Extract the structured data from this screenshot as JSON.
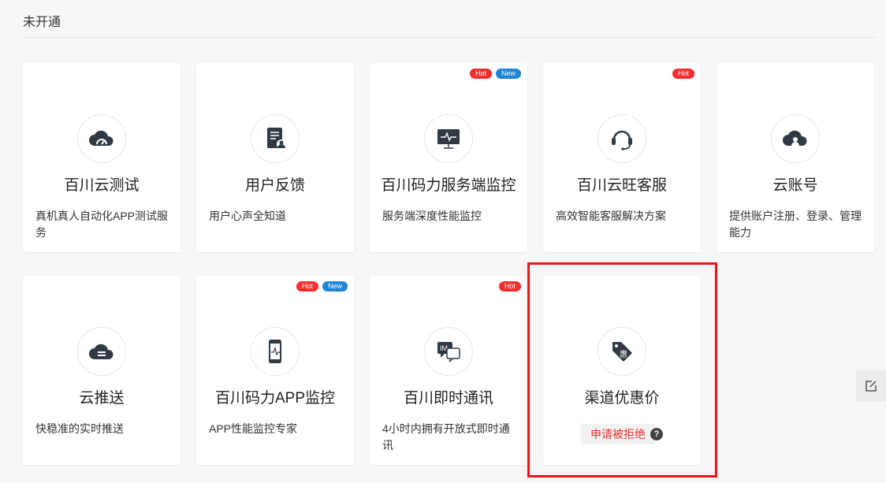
{
  "section": {
    "title": "未开通"
  },
  "cards": [
    {
      "title": "百川云测试",
      "desc": "真机真人自动化APP测试服务",
      "icon": "cloud-gauge-icon",
      "badges": []
    },
    {
      "title": "用户反馈",
      "desc": "用户心声全知道",
      "icon": "feedback-document-icon",
      "badges": []
    },
    {
      "title": "百川码力服务端监控",
      "desc": "服务端深度性能监控",
      "icon": "server-monitor-icon",
      "badges": [
        "Hot",
        "New"
      ]
    },
    {
      "title": "百川云旺客服",
      "desc": "高效智能客服解决方案",
      "icon": "headset-icon",
      "badges": [
        "Hot"
      ]
    },
    {
      "title": "云账号",
      "desc": "提供账户注册、登录、管理能力",
      "icon": "cloud-user-icon",
      "badges": []
    },
    {
      "title": "云推送",
      "desc": "快稳准的实时推送",
      "icon": "cloud-push-icon",
      "badges": []
    },
    {
      "title": "百川码力APP监控",
      "desc": "APP性能监控专家",
      "icon": "phone-monitor-icon",
      "badges": [
        "Hot",
        "New"
      ]
    },
    {
      "title": "百川即时通讯",
      "desc": "4小时内拥有开放式即时通讯",
      "icon": "im-chat-icon",
      "badges": [
        "Hot"
      ]
    },
    {
      "title": "渠道优惠价",
      "status": "申请被拒绝",
      "help": "?",
      "icon": "discount-tag-icon",
      "icon_glyph": "惠",
      "badges": []
    }
  ],
  "colors": {
    "hot": "#f0302f",
    "new": "#1d84d6",
    "rejected": "#e8302b",
    "highlight": "#e8141b"
  },
  "side_tool": {
    "icon": "edit-icon"
  }
}
